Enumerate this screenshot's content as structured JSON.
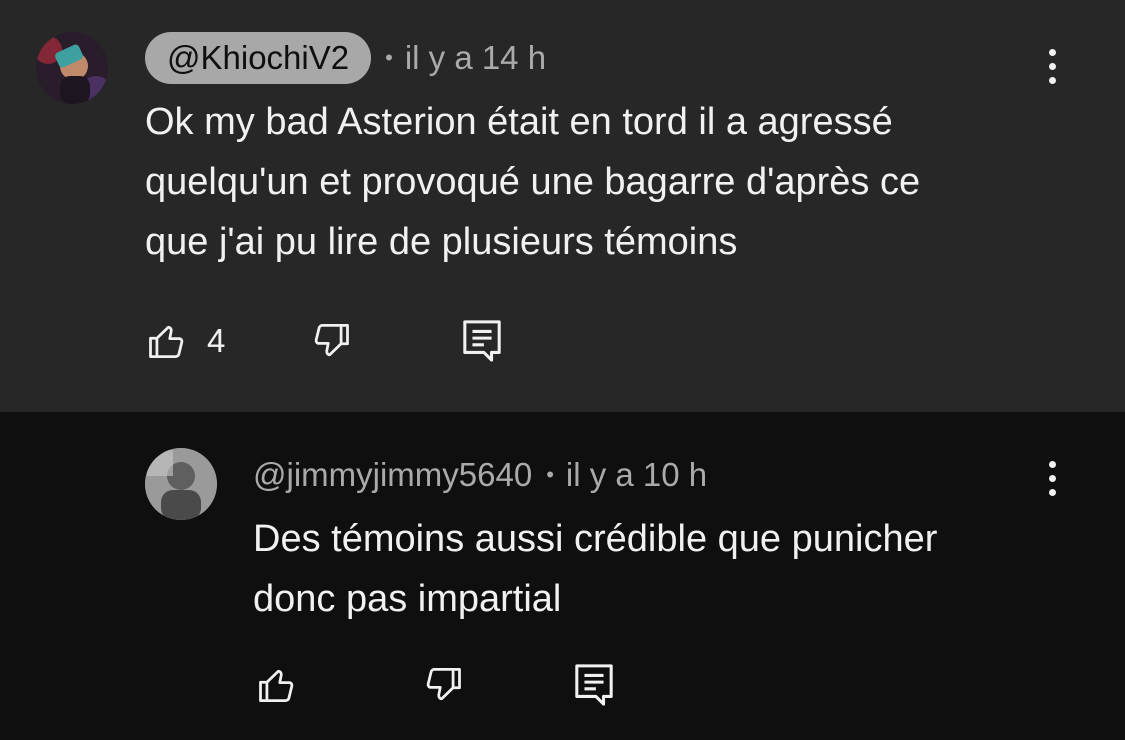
{
  "comments": [
    {
      "author": "@KhiochiV2",
      "separator": "•",
      "time": "il y a 14 h",
      "text_lines": [
        "Ok my bad Asterion était en tord il a agressé",
        "quelqu'un et provoqué une bagarre d'après ce",
        "que j'ai pu lire de plusieurs témoins"
      ],
      "likes": "4",
      "icons": {
        "like": "thumbs-up-icon",
        "dislike": "thumbs-down-icon",
        "reply": "reply-icon",
        "menu": "more-vert-icon"
      }
    },
    {
      "author": "@jimmyjimmy5640",
      "separator": "•",
      "time": "il y a 10 h",
      "text_lines": [
        "Des témoins aussi crédible que punicher",
        "donc pas impartial"
      ],
      "likes": "",
      "icons": {
        "like": "thumbs-up-icon",
        "dislike": "thumbs-down-icon",
        "reply": "reply-icon",
        "menu": "more-vert-icon"
      }
    }
  ],
  "colors": {
    "highlight_bg": "#272727",
    "page_bg": "#0f0f0f",
    "chip_bg": "#a8a8a8",
    "meta_text": "#aaaaaa"
  }
}
